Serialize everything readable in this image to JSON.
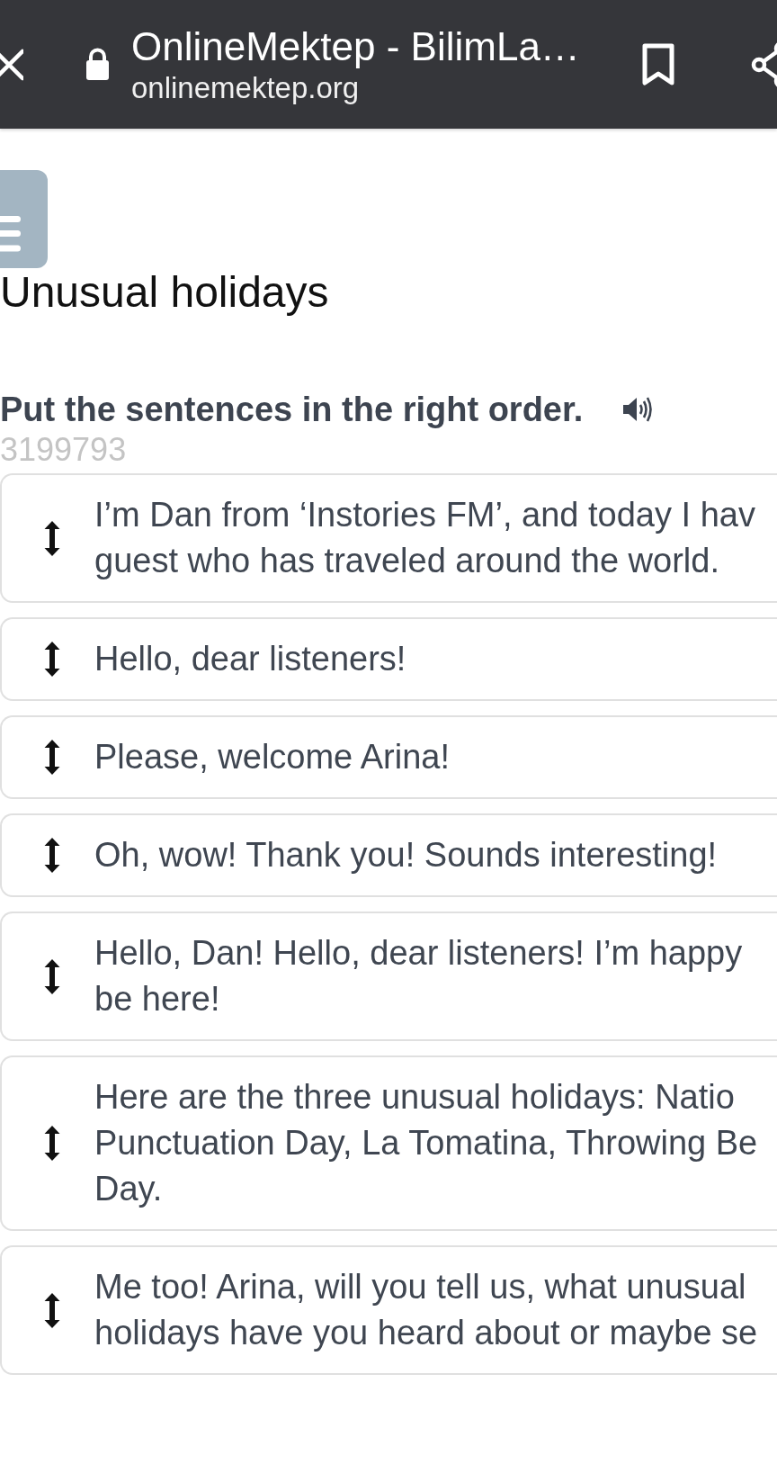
{
  "browser_bar": {
    "title": "OnlineMektep - BilimLa…",
    "url": "onlinemektep.org"
  },
  "page": {
    "title": "Unusual holidays",
    "instruction": "Put the sentences in the right order.",
    "exercise_id": "3199793"
  },
  "sentences": [
    {
      "text": "I’m Dan from ‘Instories FM’, and today I hav\nguest who has traveled around the world."
    },
    {
      "text": "Hello, dear listeners!"
    },
    {
      "text": "Please, welcome Arina!"
    },
    {
      "text": "Oh, wow! Thank you! Sounds interesting!"
    },
    {
      "text": "Hello, Dan! Hello, dear listeners! I’m happy\nbe here!"
    },
    {
      "text": "Here are the three unusual holidays: Natio\nPunctuation Day, La Tomatina, Throwing Be\nDay."
    },
    {
      "text": "Me too! Arina, will you tell us, what unusual\nholidays have you heard about or maybe se"
    }
  ]
}
